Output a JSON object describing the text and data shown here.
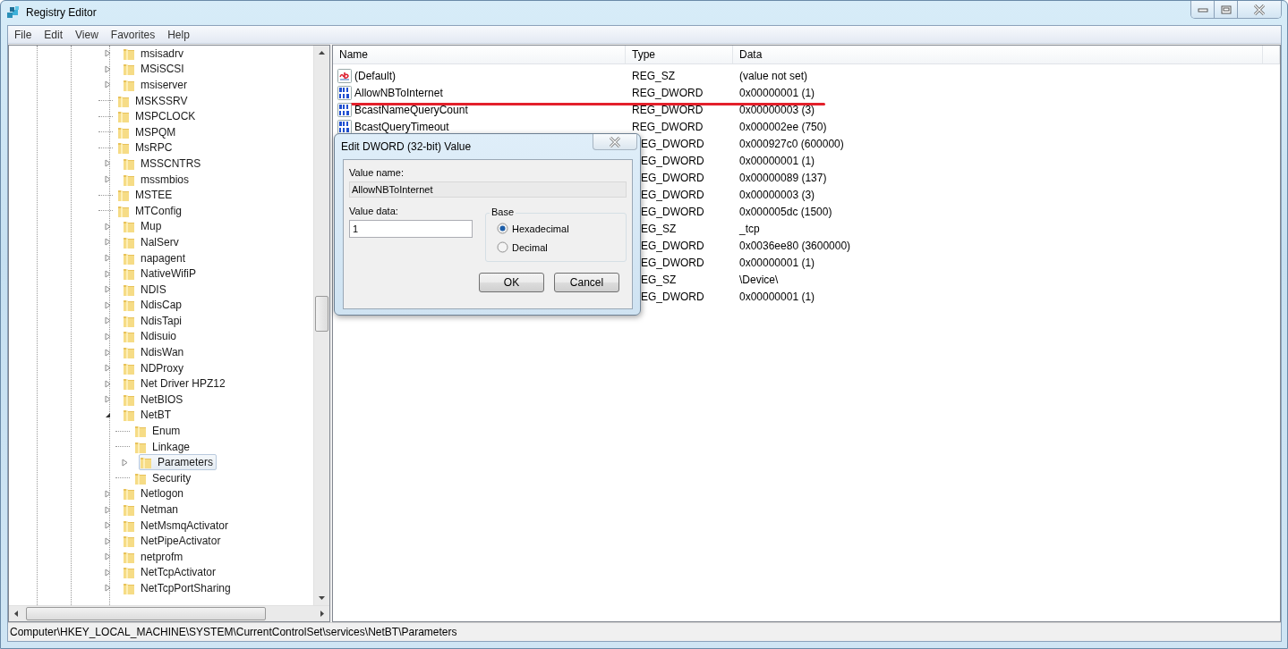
{
  "window": {
    "title": "Registry Editor"
  },
  "menu": [
    "File",
    "Edit",
    "View",
    "Favorites",
    "Help"
  ],
  "tree": [
    {
      "label": "msisadrv",
      "expandable": true,
      "expanded": false,
      "selected": false
    },
    {
      "label": "MSiSCSI",
      "expandable": true,
      "expanded": false,
      "selected": false
    },
    {
      "label": "msiserver",
      "expandable": true,
      "expanded": false,
      "selected": false
    },
    {
      "label": "MSKSSRV",
      "expandable": false,
      "selected": false
    },
    {
      "label": "MSPCLOCK",
      "expandable": false,
      "selected": false
    },
    {
      "label": "MSPQM",
      "expandable": false,
      "selected": false
    },
    {
      "label": "MsRPC",
      "expandable": false,
      "selected": false
    },
    {
      "label": "MSSCNTRS",
      "expandable": true,
      "expanded": false,
      "selected": false
    },
    {
      "label": "mssmbios",
      "expandable": true,
      "expanded": false,
      "selected": false
    },
    {
      "label": "MSTEE",
      "expandable": false,
      "selected": false
    },
    {
      "label": "MTConfig",
      "expandable": false,
      "selected": false
    },
    {
      "label": "Mup",
      "expandable": true,
      "expanded": false,
      "selected": false
    },
    {
      "label": "NalServ",
      "expandable": true,
      "expanded": false,
      "selected": false
    },
    {
      "label": "napagent",
      "expandable": true,
      "expanded": false,
      "selected": false
    },
    {
      "label": "NativeWifiP",
      "expandable": true,
      "expanded": false,
      "selected": false
    },
    {
      "label": "NDIS",
      "expandable": true,
      "expanded": false,
      "selected": false
    },
    {
      "label": "NdisCap",
      "expandable": true,
      "expanded": false,
      "selected": false
    },
    {
      "label": "NdisTapi",
      "expandable": true,
      "expanded": false,
      "selected": false
    },
    {
      "label": "Ndisuio",
      "expandable": true,
      "expanded": false,
      "selected": false
    },
    {
      "label": "NdisWan",
      "expandable": true,
      "expanded": false,
      "selected": false
    },
    {
      "label": "NDProxy",
      "expandable": true,
      "expanded": false,
      "selected": false
    },
    {
      "label": "Net Driver HPZ12",
      "expandable": true,
      "expanded": false,
      "selected": false
    },
    {
      "label": "NetBIOS",
      "expandable": true,
      "expanded": false,
      "selected": false
    },
    {
      "label": "NetBT",
      "expandable": true,
      "expanded": true,
      "selected": false,
      "children": [
        {
          "label": "Enum",
          "expandable": false,
          "selected": false
        },
        {
          "label": "Linkage",
          "expandable": false,
          "selected": false
        },
        {
          "label": "Parameters",
          "expandable": true,
          "expanded": false,
          "selected": true
        },
        {
          "label": "Security",
          "expandable": false,
          "selected": false
        }
      ]
    },
    {
      "label": "Netlogon",
      "expandable": true,
      "expanded": false,
      "selected": false
    },
    {
      "label": "Netman",
      "expandable": true,
      "expanded": false,
      "selected": false
    },
    {
      "label": "NetMsmqActivator",
      "expandable": true,
      "expanded": false,
      "selected": false
    },
    {
      "label": "NetPipeActivator",
      "expandable": true,
      "expanded": false,
      "selected": false
    },
    {
      "label": "netprofm",
      "expandable": true,
      "expanded": false,
      "selected": false
    },
    {
      "label": "NetTcpActivator",
      "expandable": true,
      "expanded": false,
      "selected": false
    },
    {
      "label": "NetTcpPortSharing",
      "expandable": true,
      "expanded": false,
      "selected": false
    }
  ],
  "list": {
    "columns": [
      "Name",
      "Type",
      "Data"
    ],
    "rows": [
      {
        "kind": "string",
        "covered": false,
        "underlined": false,
        "name": "(Default)",
        "type": "REG_SZ",
        "data": "(value not set)"
      },
      {
        "kind": "dword",
        "covered": false,
        "underlined": true,
        "name": "AllowNBToInternet",
        "type": "REG_DWORD",
        "data": "0x00000001 (1)"
      },
      {
        "kind": "dword",
        "covered": false,
        "underlined": false,
        "name": "BcastNameQueryCount",
        "type": "REG_DWORD",
        "data": "0x00000003 (3)"
      },
      {
        "kind": "dword",
        "covered": false,
        "underlined": false,
        "name": "BcastQueryTimeout",
        "type": "REG_DWORD",
        "data": "0x000002ee (750)"
      },
      {
        "covered": true,
        "underlined": false,
        "type": "EG_DWORD",
        "data": "0x000927c0 (600000)"
      },
      {
        "covered": true,
        "underlined": false,
        "type": "EG_DWORD",
        "data": "0x00000001 (1)"
      },
      {
        "covered": true,
        "underlined": false,
        "type": "EG_DWORD",
        "data": "0x00000089 (137)"
      },
      {
        "covered": true,
        "underlined": false,
        "type": "EG_DWORD",
        "data": "0x00000003 (3)"
      },
      {
        "covered": true,
        "underlined": false,
        "type": "EG_DWORD",
        "data": "0x000005dc (1500)"
      },
      {
        "covered": true,
        "underlined": false,
        "type": "EG_SZ",
        "data": "_tcp"
      },
      {
        "covered": true,
        "underlined": false,
        "type": "EG_DWORD",
        "data": "0x0036ee80 (3600000)"
      },
      {
        "covered": true,
        "underlined": false,
        "type": "EG_DWORD",
        "data": "0x00000001 (1)"
      },
      {
        "covered": true,
        "underlined": false,
        "type": "EG_SZ",
        "data": "\\Device\\"
      },
      {
        "covered": true,
        "underlined": false,
        "type": "EG_DWORD",
        "data": "0x00000001 (1)"
      }
    ]
  },
  "dialog": {
    "title": "Edit DWORD (32-bit) Value",
    "value_name_label": "Value name:",
    "value_name": "AllowNBToInternet",
    "value_data_label": "Value data:",
    "value_data": "1",
    "base_label": "Base",
    "bases": [
      {
        "label": "Hexadecimal",
        "selected": true
      },
      {
        "label": "Decimal",
        "selected": false
      }
    ],
    "buttons": [
      "OK",
      "Cancel"
    ]
  },
  "status_bar": "Computer\\HKEY_LOCAL_MACHINE\\SYSTEM\\CurrentControlSet\\services\\NetBT\\Parameters"
}
